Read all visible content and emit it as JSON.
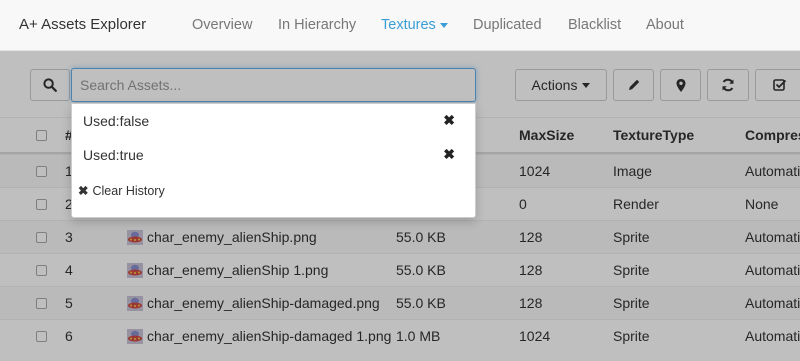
{
  "app": {
    "brand": "A+ Assets Explorer"
  },
  "nav": {
    "overview": "Overview",
    "in_hierarchy": "In Hierarchy",
    "textures": "Textures",
    "duplicated": "Duplicated",
    "blacklist": "Blacklist",
    "about": "About"
  },
  "toolbar": {
    "search_placeholder": "Search Assets...",
    "actions_label": "Actions"
  },
  "search_history": {
    "items": [
      "Used:false",
      "Used:true"
    ],
    "remove_glyph": "✖",
    "clear_label": "Clear History",
    "clear_glyph": "✖"
  },
  "table": {
    "headers": [
      "#",
      "MaxSize",
      "TextureType",
      "Compres"
    ],
    "rows": [
      {
        "num": "1",
        "name": "",
        "size": "",
        "maxsize": "1024",
        "type": "Image",
        "compression": "Automati"
      },
      {
        "num": "2",
        "name": "",
        "size": "",
        "maxsize": "0",
        "type": "Render",
        "compression": "None"
      },
      {
        "num": "3",
        "name": "char_enemy_alienShip.png",
        "size": "55.0 KB",
        "maxsize": "128",
        "type": "Sprite",
        "compression": "Automati"
      },
      {
        "num": "4",
        "name": "char_enemy_alienShip 1.png",
        "size": "55.0 KB",
        "maxsize": "128",
        "type": "Sprite",
        "compression": "Automati"
      },
      {
        "num": "5",
        "name": "char_enemy_alienShip-damaged.png",
        "size": "55.0 KB",
        "maxsize": "128",
        "type": "Sprite",
        "compression": "Automati"
      },
      {
        "num": "6",
        "name": "char_enemy_alienShip-damaged 1.png",
        "size": "1.0 MB",
        "maxsize": "1024",
        "type": "Sprite",
        "compression": "Automati"
      }
    ]
  },
  "colors": {
    "accent": "#3a9ed6",
    "focus_border": "#66afe9"
  }
}
